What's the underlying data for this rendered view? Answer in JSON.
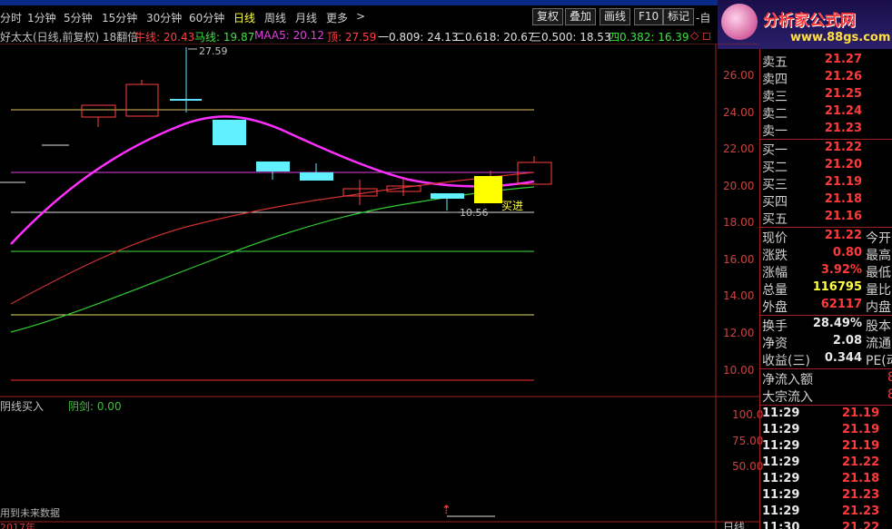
{
  "toolbar": {
    "periods": [
      "分时",
      "1分钟",
      "5分钟",
      "15分钟",
      "30分钟",
      "60分钟",
      "日线",
      "周线",
      "月线",
      "更多"
    ],
    "more_arrow": ">",
    "active_period": "日线",
    "buttons": [
      "复权",
      "叠加",
      "画线",
      "F10",
      "标记"
    ],
    "extra": "-自"
  },
  "brand": {
    "title": "分析家公式网",
    "url": "www.88gs.com"
  },
  "legend": {
    "stock_name": "好太太(日线,前复权) 18翻倍",
    "niu_label": "牛线: 20.43",
    "ma_label": "马线: 19.87",
    "maa5_label": "MAA5: 20.12",
    "top_label": "顶: 27.59",
    "f1_label": "一0.809: 24.13",
    "f2_label": "二0.618: 20.67",
    "f3_label": "三0.500: 18.53",
    "f4_label": "四0.382: 16.39",
    "marks": "◇ ◻"
  },
  "chart_annotations": {
    "high": "27.59",
    "low": "10.56",
    "signal": "买进"
  },
  "y_ticks": [
    "26.00",
    "24.00",
    "22.00",
    "20.00",
    "18.00",
    "16.00",
    "14.00",
    "12.00",
    "10.00"
  ],
  "vol_ticks": [
    "100.0",
    "75.00",
    "50.00"
  ],
  "sub": {
    "name": "阴线买入",
    "value": "阴剑: 0.00",
    "future_note": "用到未来数据",
    "year": "2017年",
    "period": "日线"
  },
  "quote": {
    "orders": [
      {
        "label": "卖五",
        "price": "21.27"
      },
      {
        "label": "卖四",
        "price": "21.26"
      },
      {
        "label": "卖三",
        "price": "21.25"
      },
      {
        "label": "卖二",
        "price": "21.24"
      },
      {
        "label": "卖一",
        "price": "21.23"
      },
      {
        "label": "买一",
        "price": "21.22"
      },
      {
        "label": "买二",
        "price": "21.20"
      },
      {
        "label": "买三",
        "price": "21.19"
      },
      {
        "label": "买四",
        "price": "21.18"
      },
      {
        "label": "买五",
        "price": "21.16"
      }
    ],
    "stats": [
      {
        "label": "现价",
        "value": "21.22",
        "extra": "今开"
      },
      {
        "label": "涨跌",
        "value": "0.80",
        "extra": "最高"
      },
      {
        "label": "涨幅",
        "value": "3.92%",
        "extra": "最低"
      },
      {
        "label": "总量",
        "value": "116795",
        "extra": "量比"
      },
      {
        "label": "外盘",
        "value": "62117",
        "extra": "内盘"
      }
    ],
    "finance": [
      {
        "label": "换手",
        "value": "28.49%",
        "extra": "股本"
      },
      {
        "label": "净资",
        "value": "2.08",
        "extra": "流通"
      },
      {
        "label": "收益(三)",
        "value": "0.344",
        "extra": "PE(动"
      }
    ],
    "flows": [
      {
        "label": "净流入额",
        "value": "",
        "extra": "8"
      },
      {
        "label": "大宗流入",
        "value": "",
        "extra": "8"
      }
    ],
    "ticks": [
      {
        "time": "11:29",
        "price": "21.19"
      },
      {
        "time": "11:29",
        "price": "21.19"
      },
      {
        "time": "11:29",
        "price": "21.19"
      },
      {
        "time": "11:29",
        "price": "21.22"
      },
      {
        "time": "11:29",
        "price": "21.18"
      },
      {
        "time": "11:29",
        "price": "21.23"
      },
      {
        "time": "11:29",
        "price": "21.23"
      },
      {
        "time": "11:30",
        "price": "21.22"
      }
    ]
  }
}
